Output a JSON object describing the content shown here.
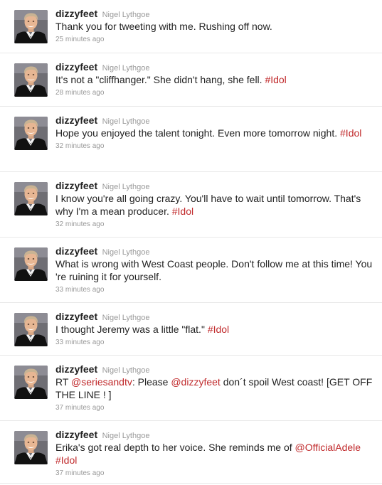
{
  "colors": {
    "link": "#c0292b",
    "meta": "#999999",
    "text": "#222222",
    "divider": "#e8e8e8"
  },
  "tweets": [
    {
      "screen_name": "dizzyfeet",
      "full_name": "Nigel Lythgoe",
      "parts": [
        {
          "t": "Thank you for tweeting with me. Rushing off now."
        }
      ],
      "time": "25 minutes ago"
    },
    {
      "screen_name": "dizzyfeet",
      "full_name": "Nigel Lythgoe",
      "parts": [
        {
          "t": "It's not a \"cliffhanger.\" She didn't hang, she fell. "
        },
        {
          "t": "#Idol",
          "link": true
        }
      ],
      "time": "28 minutes ago"
    },
    {
      "screen_name": "dizzyfeet",
      "full_name": "Nigel Lythgoe",
      "parts": [
        {
          "t": "Hope you enjoyed the talent tonight. Even more tomorrow night. "
        },
        {
          "t": "#Idol",
          "link": true
        }
      ],
      "time": "32 minutes ago"
    },
    {
      "screen_name": "dizzyfeet",
      "full_name": "Nigel Lythgoe",
      "parts": [
        {
          "t": "I know you're all going crazy. You'll have to wait until tomorrow. That's why I'm a mean producer. "
        },
        {
          "t": "#Idol",
          "link": true
        }
      ],
      "time": "32 minutes ago"
    },
    {
      "screen_name": "dizzyfeet",
      "full_name": "Nigel Lythgoe",
      "parts": [
        {
          "t": "What is wrong with West Coast people. Don't follow me at this time! You 're ruining it for yourself."
        }
      ],
      "time": "33 minutes ago"
    },
    {
      "screen_name": "dizzyfeet",
      "full_name": "Nigel Lythgoe",
      "parts": [
        {
          "t": "I thought Jeremy was a little \"flat.\" "
        },
        {
          "t": "#Idol",
          "link": true
        }
      ],
      "time": "33 minutes ago"
    },
    {
      "screen_name": "dizzyfeet",
      "full_name": "Nigel Lythgoe",
      "parts": [
        {
          "t": "RT "
        },
        {
          "t": "@seriesandtv",
          "link": true
        },
        {
          "t": ": Please "
        },
        {
          "t": "@dizzyfeet",
          "link": true
        },
        {
          "t": " don´t spoil West coast! [GET OFF THE LINE ! ]"
        }
      ],
      "time": "37 minutes ago"
    },
    {
      "screen_name": "dizzyfeet",
      "full_name": "Nigel Lythgoe",
      "parts": [
        {
          "t": "Erika's got real depth to her voice. She reminds me of "
        },
        {
          "t": "@OfficialAdele",
          "link": true
        },
        {
          "t": " "
        },
        {
          "t": "#Idol",
          "link": true
        }
      ],
      "time": "37 minutes ago"
    }
  ]
}
